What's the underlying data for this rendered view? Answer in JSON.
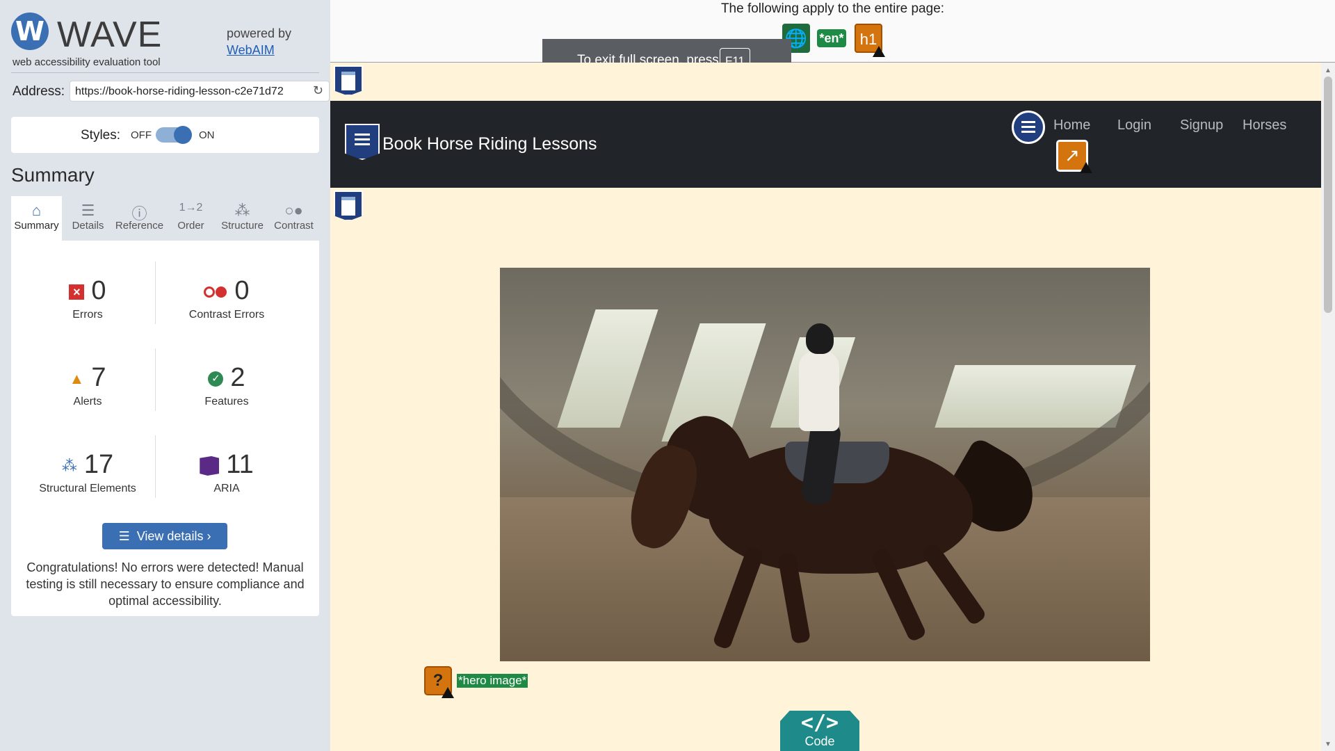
{
  "wave": {
    "logo_letter": "W",
    "title": "WAVE",
    "subtitle": "web accessibility evaluation tool",
    "powered_by": "powered by",
    "powered_link": "WebAIM",
    "address_label": "Address:",
    "address_value": "https://book-horse-riding-lesson-c2e71d72",
    "styles_label": "Styles:",
    "styles_off": "OFF",
    "styles_on": "ON",
    "summary_heading": "Summary",
    "tabs": [
      {
        "label": "Summary",
        "icon": "home-icon",
        "active": true
      },
      {
        "label": "Details",
        "icon": "list-icon",
        "active": false
      },
      {
        "label": "Reference",
        "icon": "info-icon",
        "active": false
      },
      {
        "label": "Order",
        "icon": "order-icon",
        "active": false
      },
      {
        "label": "Structure",
        "icon": "structure-icon",
        "active": false
      },
      {
        "label": "Contrast",
        "icon": "contrast-icon",
        "active": false
      }
    ],
    "metrics": {
      "errors": {
        "value": "0",
        "label": "Errors"
      },
      "contrast_errors": {
        "value": "0",
        "label": "Contrast Errors"
      },
      "alerts": {
        "value": "7",
        "label": "Alerts"
      },
      "features": {
        "value": "2",
        "label": "Features"
      },
      "structural": {
        "value": "17",
        "label": "Structural Elements"
      },
      "aria": {
        "value": "11",
        "label": "ARIA"
      }
    },
    "view_details": "View details ›",
    "congrats": "Congratulations! No errors were detected! Manual testing is still necessary to ensure compliance and optimal accessibility."
  },
  "viewer": {
    "page_note": "The following apply to the entire page:",
    "badge_en": "*en*",
    "badge_h1": "h1",
    "fullscreen_text": "To exit full screen, press",
    "fullscreen_key": "F11",
    "site_brand": "Book Horse Riding Lessons",
    "nav_links": [
      "Home",
      "Login",
      "Signup",
      "Horses"
    ],
    "alt_label": "*hero image*",
    "alt_alert": "?",
    "code_glyph": "</>",
    "code_label": "Code"
  },
  "colors": {
    "wave_blue": "#3b6fb3",
    "error_red": "#d3302f",
    "alert_orange": "#d4740f",
    "feature_green": "#2e8a55",
    "aria_purple": "#5a2a86",
    "page_bg": "#fff3da",
    "nav_bg": "#212529"
  }
}
